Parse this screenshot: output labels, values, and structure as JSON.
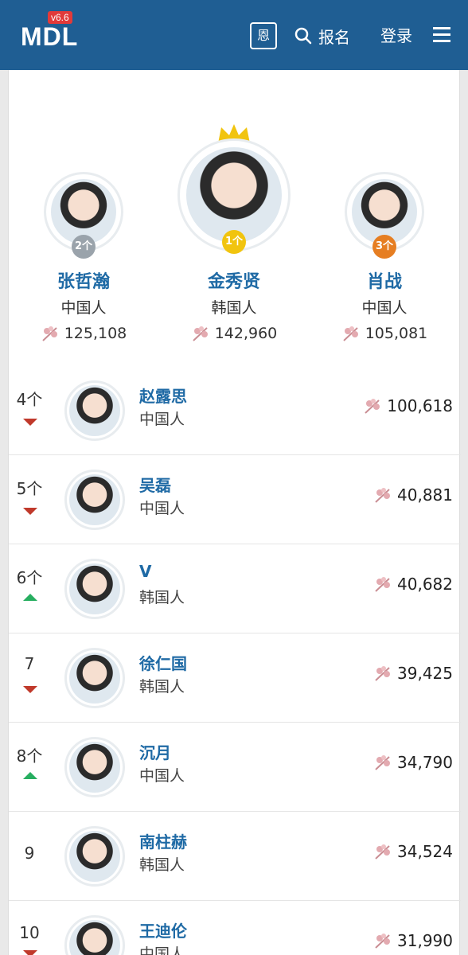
{
  "header": {
    "logo": "MDL",
    "version": "v6.6",
    "box_label": "恩",
    "search_label": "报名",
    "login_label": "登录"
  },
  "podium": [
    {
      "rank_label": "2个",
      "name": "张哲瀚",
      "nationality": "中国人",
      "score": "125,108",
      "badge_color": "#9aa3ab"
    },
    {
      "rank_label": "1个",
      "name": "金秀贤",
      "nationality": "韩国人",
      "score": "142,960",
      "badge_color": "#f1c40f"
    },
    {
      "rank_label": "3个",
      "name": "肖战",
      "nationality": "中国人",
      "score": "105,081",
      "badge_color": "#e67e22"
    }
  ],
  "list": [
    {
      "rank": "4个",
      "trend": "down",
      "name": "赵露思",
      "nationality": "中国人",
      "score": "100,618"
    },
    {
      "rank": "5个",
      "trend": "down",
      "name": "吴磊",
      "nationality": "中国人",
      "score": "40,881"
    },
    {
      "rank": "6个",
      "trend": "up",
      "name": "V",
      "nationality": "韩国人",
      "score": "40,682"
    },
    {
      "rank": "7",
      "trend": "down",
      "name": "徐仁国",
      "nationality": "韩国人",
      "score": "39,425"
    },
    {
      "rank": "8个",
      "trend": "up",
      "name": "沉月",
      "nationality": "中国人",
      "score": "34,790"
    },
    {
      "rank": "9",
      "trend": "none",
      "name": "南柱赫",
      "nationality": "韩国人",
      "score": "34,524"
    },
    {
      "rank": "10",
      "trend": "down",
      "name": "王迪伦",
      "nationality": "中国人",
      "score": "31,990"
    }
  ],
  "colors": {
    "header": "#1f5e93",
    "name_link": "#1f6aa5",
    "up": "#27ae60",
    "down": "#c0392b",
    "flower": "#d89aa0"
  },
  "icons": [
    "search-icon",
    "menu-icon",
    "crown-icon",
    "flower-icon"
  ]
}
